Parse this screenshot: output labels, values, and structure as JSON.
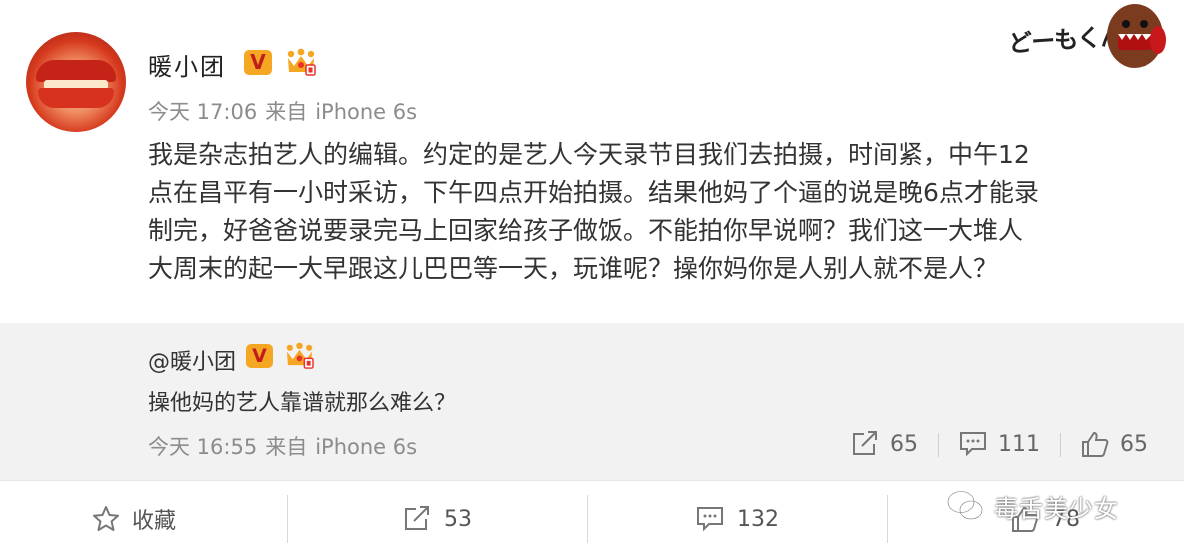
{
  "post": {
    "username": "暖小团",
    "timestamp": "今天 17:06",
    "source_prefix": "来自",
    "source": "iPhone 6s",
    "verified_badge": "V",
    "body_lines": [
      "我是杂志拍艺人的编辑。约定的是艺人今天录节目我们去拍摄，时间紧，中午12",
      "点在昌平有一小时采访，下午四点开始拍摄。结果他妈了个逼的说是晚6点才能录",
      "制完，好爸爸说要录完马上回家给孩子做饭。不能拍你早说啊？我们这一大堆人",
      "大周末的起一大早跟这儿巴巴等一天，玩谁呢？操你妈你是人别人就不是人？"
    ]
  },
  "logo": {
    "text": "どーもくん"
  },
  "quoted": {
    "username": "@暖小团",
    "verified_badge": "V",
    "text": "操他妈的艺人靠谱就那么难么？",
    "timestamp": "今天 16:55",
    "source_prefix": "来自",
    "source": "iPhone 6s",
    "reposts": "65",
    "comments": "111",
    "likes": "65"
  },
  "actions": {
    "favorite_label": "收藏",
    "reposts": "53",
    "comments": "132",
    "likes": "78"
  },
  "watermark": {
    "text": "毒舌美少女"
  },
  "icons": {
    "star": "star-icon",
    "repost": "repost-icon",
    "comment": "comment-icon",
    "like": "thumbs-up-icon",
    "crown": "crown-icon",
    "wechat": "wechat-icon"
  },
  "colors": {
    "badge": "#f5a623",
    "badge_text": "#c01d1d",
    "meta": "#8c8c8c",
    "quote_bg": "#f2f2f2"
  }
}
